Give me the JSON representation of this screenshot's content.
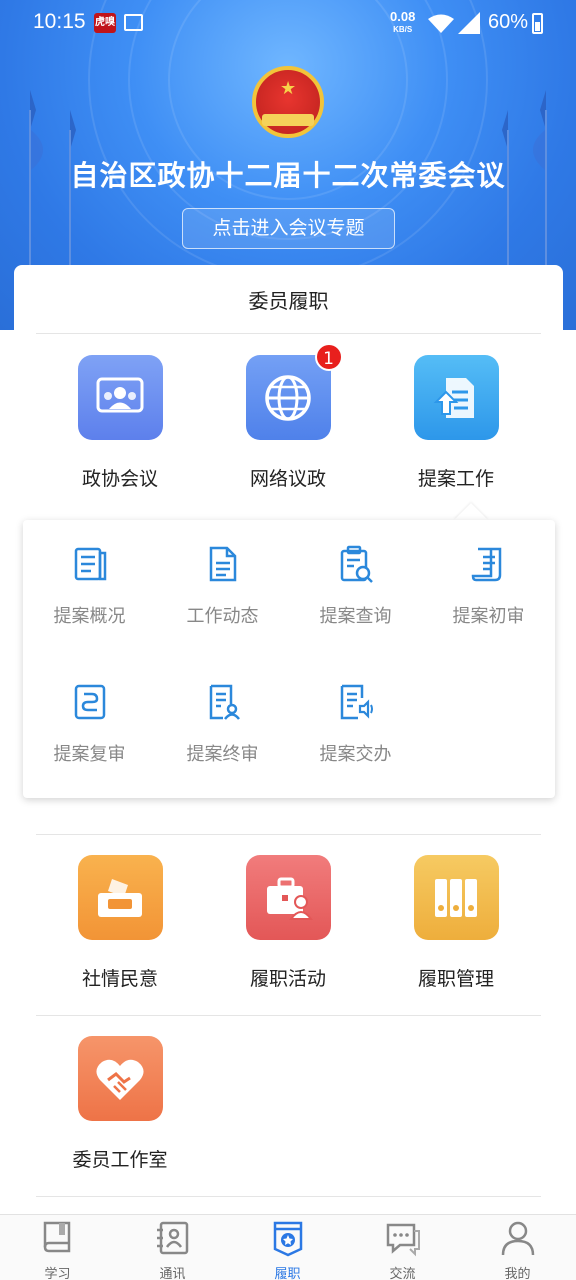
{
  "status_bar": {
    "time": "10:15",
    "app_badge": "虎嗅",
    "net_speed": "0.08",
    "net_unit": "KB/S",
    "battery": "60%"
  },
  "banner": {
    "title": "自治区政协十二届十二次常委会议",
    "button": "点击进入会议专题"
  },
  "card": {
    "title": "委员履职",
    "row1": [
      {
        "label": "政协会议",
        "icon": "meeting-icon",
        "color": "#6f8ff1"
      },
      {
        "label": "网络议政",
        "icon": "globe-icon",
        "color": "#5e8ff0",
        "badge": "1"
      },
      {
        "label": "提案工作",
        "icon": "proposal-upload-icon",
        "color": "#3aa8f0"
      }
    ],
    "submenu": [
      {
        "label": "提案概况",
        "icon": "document-list-icon"
      },
      {
        "label": "工作动态",
        "icon": "file-text-icon"
      },
      {
        "label": "提案查询",
        "icon": "clipboard-search-icon"
      },
      {
        "label": "提案初审",
        "icon": "scroll-review-icon"
      },
      {
        "label": "提案复审",
        "icon": "loop-review-icon"
      },
      {
        "label": "提案终审",
        "icon": "document-user-icon"
      },
      {
        "label": "提案交办",
        "icon": "document-broadcast-icon"
      }
    ],
    "row2": [
      {
        "label": "社情民意",
        "icon": "mailbox-icon",
        "color": "#f5a43f"
      },
      {
        "label": "履职活动",
        "icon": "briefcase-user-icon",
        "color": "#ea6a6a"
      },
      {
        "label": "履职管理",
        "icon": "binders-icon",
        "color": "#f1bc4c"
      }
    ],
    "row3": [
      {
        "label": "委员工作室",
        "icon": "heart-handshake-icon",
        "color": "#f1845a"
      }
    ]
  },
  "bottom_nav": {
    "active_color": "#2b78e4",
    "items": [
      {
        "label": "学习",
        "icon": "book-icon"
      },
      {
        "label": "通讯",
        "icon": "contacts-icon"
      },
      {
        "label": "履职",
        "icon": "badge-star-icon",
        "active": true
      },
      {
        "label": "交流",
        "icon": "chat-icon"
      },
      {
        "label": "我的",
        "icon": "person-icon"
      }
    ]
  }
}
